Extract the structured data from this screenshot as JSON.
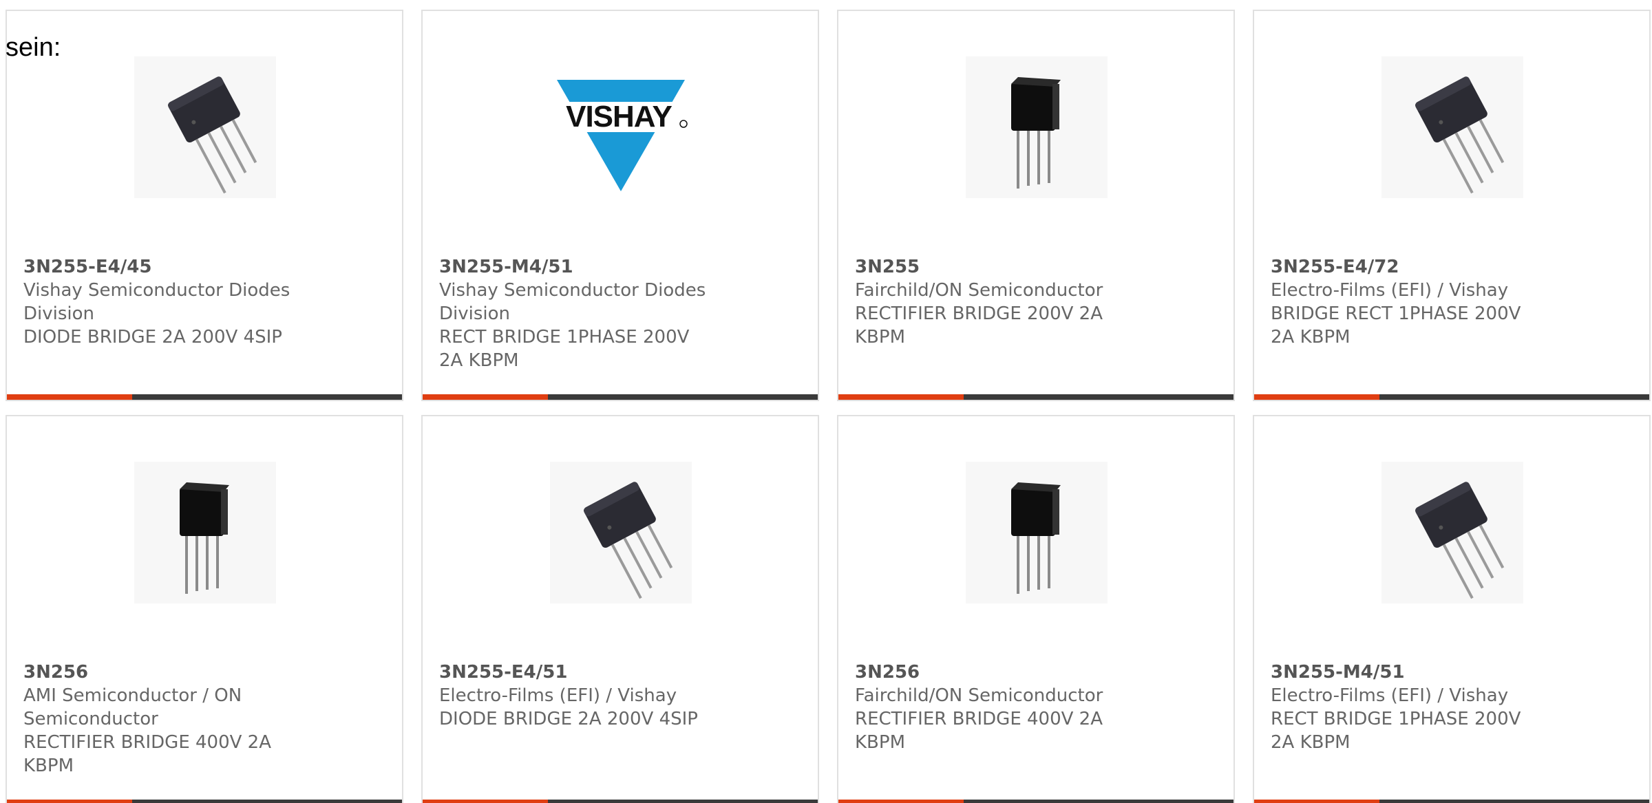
{
  "intro_text": "sein:",
  "colors": {
    "accent": "#e03e12",
    "bar": "#3a3a3a",
    "text": "#666666",
    "vishay_blue": "#1a9ad6"
  },
  "products": [
    {
      "pn": "3N255-E4/45",
      "mfr": "Vishay Semiconductor Diodes Division",
      "desc": "DIODE BRIDGE 2A 200V 4SIP",
      "image": "tilted-bridge-rectifier-icon"
    },
    {
      "pn": "3N255-M4/51",
      "mfr": "Vishay Semiconductor Diodes Division",
      "desc": "RECT BRIDGE 1PHASE 200V 2A KBPM",
      "image": "vishay-logo"
    },
    {
      "pn": "3N255",
      "mfr": "Fairchild/ON Semiconductor",
      "desc": "RECTIFIER BRIDGE 200V 2A KBPM",
      "image": "upright-bridge-rectifier-icon"
    },
    {
      "pn": "3N255-E4/72",
      "mfr": "Electro-Films (EFI) / Vishay",
      "desc": "BRIDGE RECT 1PHASE 200V 2A KBPM",
      "image": "tilted-bridge-rectifier-icon"
    },
    {
      "pn": "3N256",
      "mfr": "AMI Semiconductor / ON Semiconductor",
      "desc": "RECTIFIER BRIDGE 400V 2A KBPM",
      "image": "upright-bridge-rectifier-icon"
    },
    {
      "pn": "3N255-E4/51",
      "mfr": "Electro-Films (EFI) / Vishay",
      "desc": "DIODE BRIDGE 2A 200V 4SIP",
      "image": "tilted-bridge-rectifier-icon"
    },
    {
      "pn": "3N256",
      "mfr": "Fairchild/ON Semiconductor",
      "desc": "RECTIFIER BRIDGE 400V 2A KBPM",
      "image": "upright-bridge-rectifier-icon"
    },
    {
      "pn": "3N255-M4/51",
      "mfr": "Electro-Films (EFI) / Vishay",
      "desc": "RECT BRIDGE 1PHASE 200V 2A KBPM",
      "image": "tilted-bridge-rectifier-icon"
    }
  ],
  "vishay_logo_text": "VISHAY"
}
